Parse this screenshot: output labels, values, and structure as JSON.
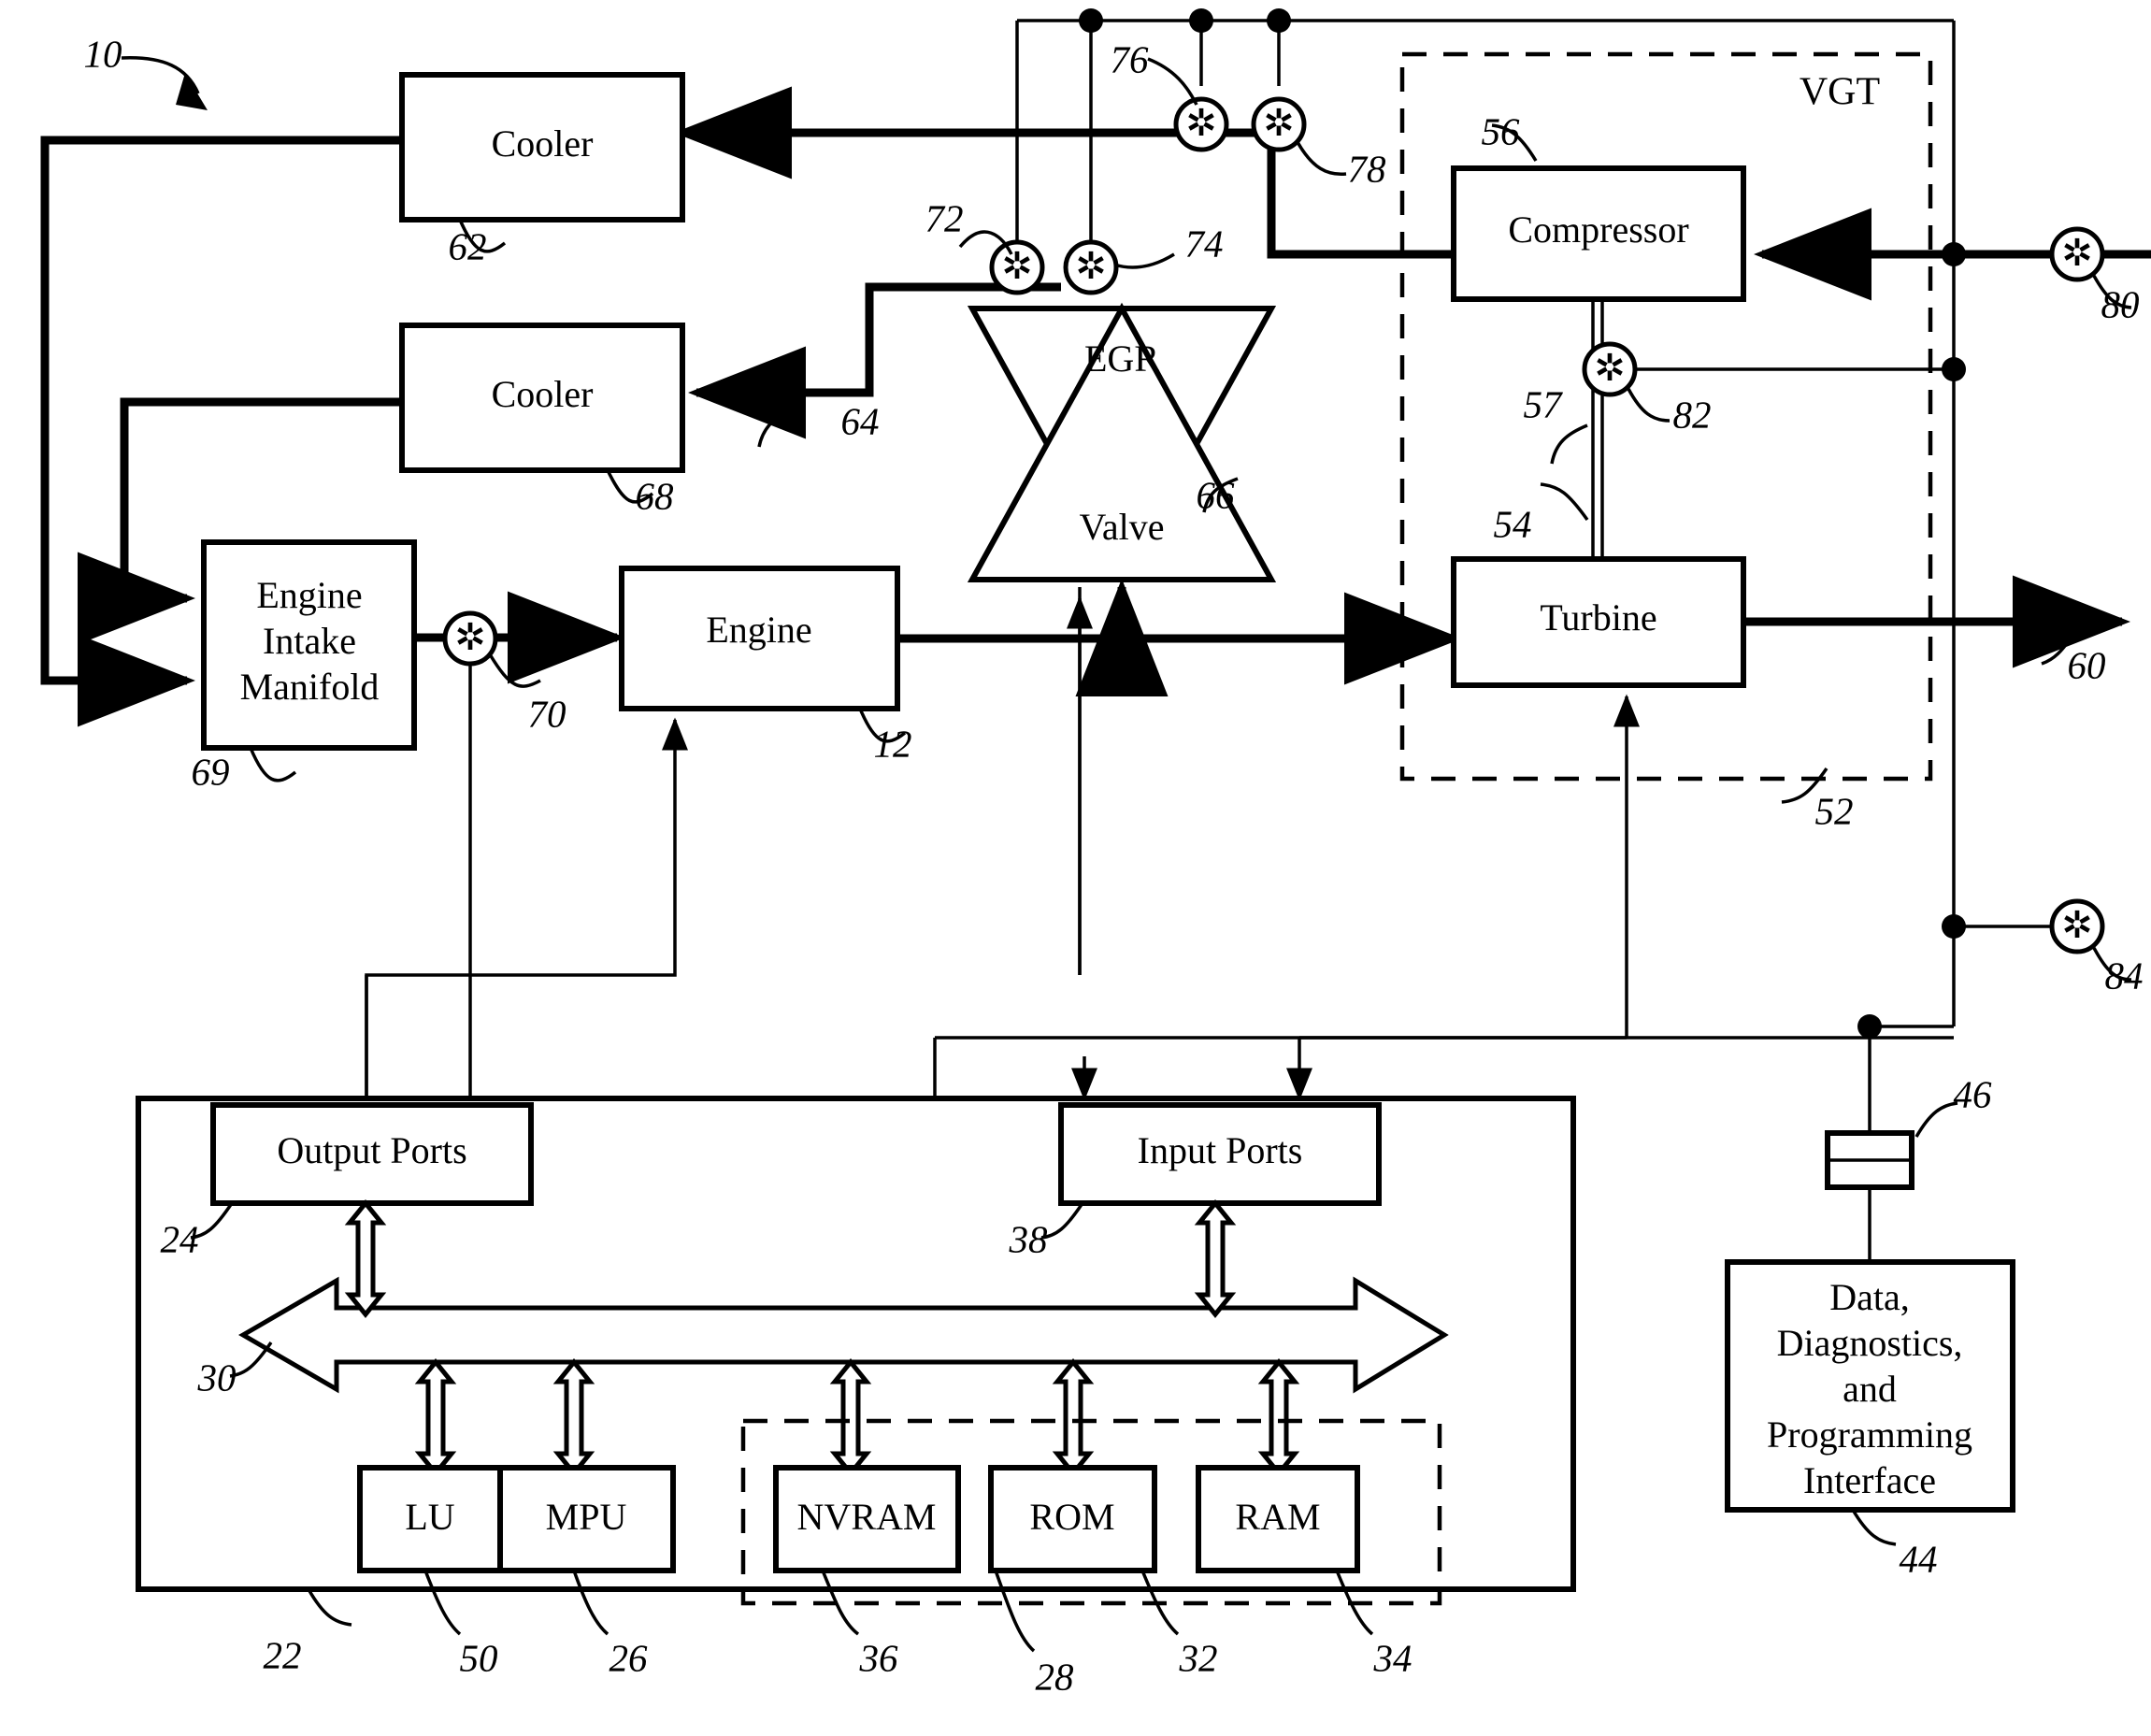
{
  "figure": {
    "id": "10",
    "type": "patent-block-diagram",
    "title_ref": "10"
  },
  "blocks": {
    "cooler_top": {
      "label": "Cooler",
      "ref": "62"
    },
    "cooler_mid": {
      "label": "Cooler",
      "ref": "68"
    },
    "intake_manifold": {
      "label_line1": "Engine",
      "label_line2": "Intake",
      "label_line3": "Manifold",
      "ref": "69"
    },
    "engine": {
      "label": "Engine",
      "ref": "12"
    },
    "egr_valve": {
      "label_top": "EGR",
      "label_bottom": "Valve",
      "ref": "66"
    },
    "compressor": {
      "label": "Compressor",
      "ref": "56"
    },
    "turbine": {
      "label": "Turbine",
      "ref": "54"
    },
    "vgt_group": {
      "label": "VGT",
      "ref": "52"
    },
    "shaft": {
      "ref": "57"
    },
    "output_ports": {
      "label": "Output Ports",
      "ref": "24"
    },
    "input_ports": {
      "label": "Input Ports",
      "ref": "38"
    },
    "bus": {
      "ref": "30"
    },
    "lu": {
      "label": "LU",
      "ref": "50"
    },
    "mpu": {
      "label": "MPU",
      "ref": "26"
    },
    "nvram": {
      "label": "NVRAM",
      "ref": "36"
    },
    "rom": {
      "label": "ROM",
      "ref": "32"
    },
    "ram": {
      "label": "RAM",
      "ref": "34"
    },
    "memory_group": {
      "ref": "28"
    },
    "control_computer": {
      "ref": "22"
    },
    "interface": {
      "label_line1": "Data,",
      "label_line2": "Diagnostics,",
      "label_line3": "and",
      "label_line4": "Programming",
      "label_line5": "Interface",
      "ref": "44"
    },
    "connector": {
      "ref": "46"
    }
  },
  "sensors": [
    {
      "ref": "70",
      "name": "intake-manifold-sensor"
    },
    {
      "ref": "72",
      "name": "egr-upstream-sensor"
    },
    {
      "ref": "74",
      "name": "egr-downstream-sensor"
    },
    {
      "ref": "76",
      "name": "exhaust-sensor"
    },
    {
      "ref": "78",
      "name": "compressor-outlet-sensor"
    },
    {
      "ref": "80",
      "name": "compressor-inlet-sensor"
    },
    {
      "ref": "82",
      "name": "turbo-shaft-speed-sensor"
    },
    {
      "ref": "84",
      "name": "datalink-sensor"
    }
  ],
  "flow_refs": {
    "egr_to_cooler": "64",
    "exhaust_out": "60"
  },
  "colors": {
    "line": "#000000",
    "fill": "#ffffff"
  }
}
